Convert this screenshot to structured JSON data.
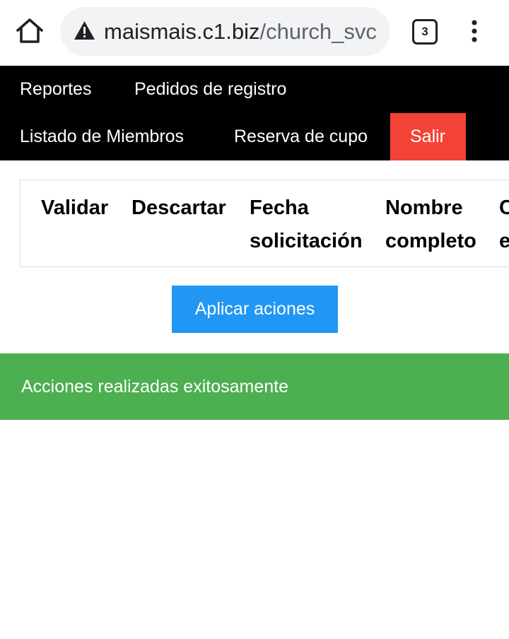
{
  "browser": {
    "url_host": "maismais.c1.biz",
    "url_path": "/church_svc",
    "tab_count": "3",
    "icons": {
      "home": "home-icon",
      "warning": "warning-icon",
      "tabs": "tabs-icon",
      "menu": "more-vert-icon"
    }
  },
  "nav": {
    "items": [
      {
        "label": "Reportes"
      },
      {
        "label": "Pedidos de registro"
      },
      {
        "label": "Listado de Miembros"
      },
      {
        "label": "Reserva de cupo"
      },
      {
        "label": "Salir"
      }
    ]
  },
  "table": {
    "headers": [
      "Validar",
      "Descartar",
      "Fecha\nsolicitación",
      "Nombre\ncompleto",
      "C\ne"
    ]
  },
  "actions": {
    "apply_label": "Aplicar aciones"
  },
  "alert": {
    "message": "Acciones realizadas exitosamente"
  },
  "colors": {
    "nav_bg": "#000000",
    "logout_bg": "#f44336",
    "button_bg": "#2196f3",
    "alert_bg": "#4caf50"
  }
}
